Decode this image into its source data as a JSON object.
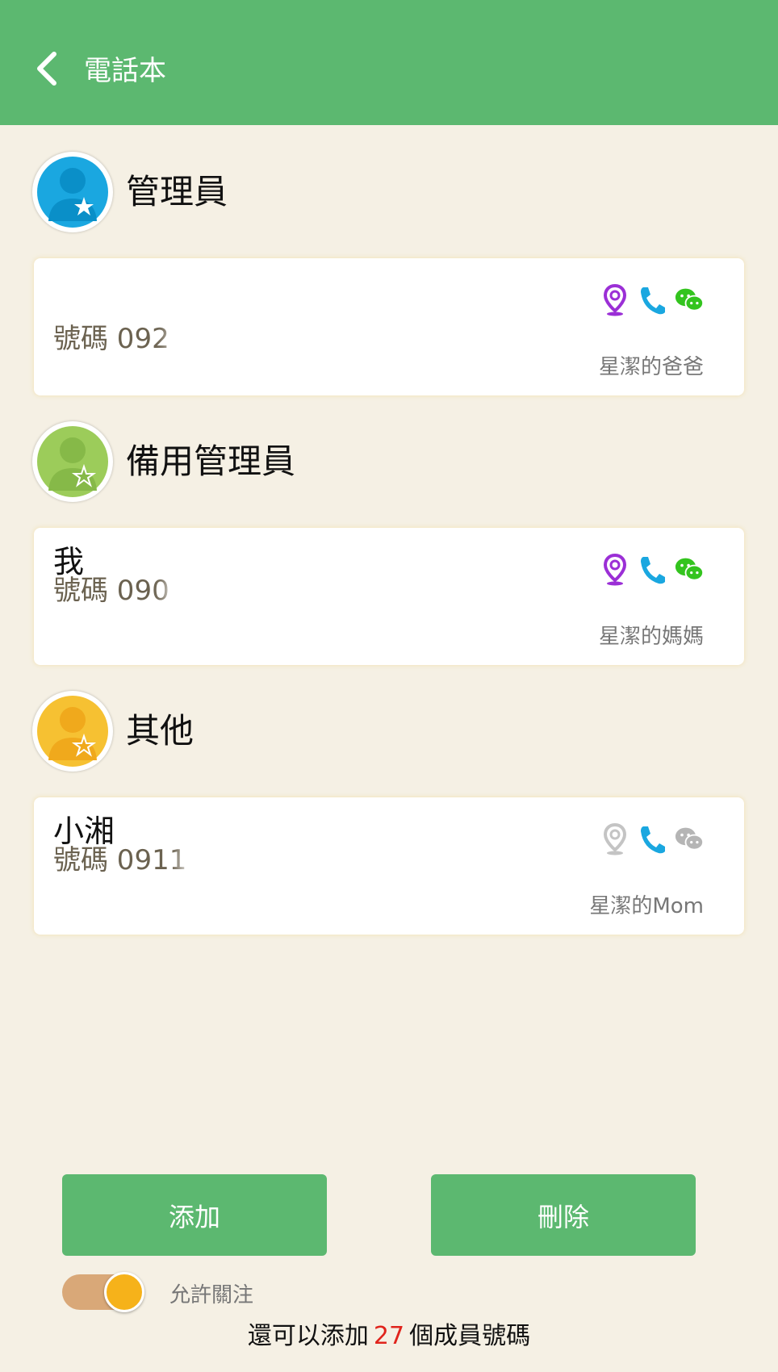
{
  "header": {
    "title": "電話本"
  },
  "groups": [
    {
      "title": "管理員",
      "avatar_color": "#1aa7e0",
      "contact": {
        "name": "",
        "phone": "號碼 092",
        "relation": "星潔的爸爸",
        "icons": [
          "location-icon",
          "phone-icon",
          "wechat-icon"
        ],
        "active": true
      }
    },
    {
      "title": "備用管理員",
      "avatar_color": "#9ccc5a",
      "contact": {
        "name": "我",
        "phone": "號碼 090",
        "relation": "星潔的媽媽",
        "icons": [
          "location-icon",
          "phone-icon",
          "wechat-icon"
        ],
        "active": true
      }
    },
    {
      "title": "其他",
      "avatar_color": "#f6c132",
      "contact": {
        "name": "小湘",
        "phone": "號碼 0911",
        "relation": "星潔的Mom",
        "icons": [
          "location-icon",
          "phone-icon",
          "wechat-icon"
        ],
        "active": false
      }
    }
  ],
  "buttons": {
    "add": "添加",
    "delete": "刪除"
  },
  "toggle": {
    "label": "允許關注",
    "on": true
  },
  "footer": {
    "prefix": "還可以添加",
    "count": "27",
    "suffix": "個成員號碼"
  },
  "colors": {
    "header": "#5cb870",
    "location_active": "#9b2fd6",
    "phone": "#1aa7e0",
    "wechat_active": "#33c41e",
    "inactive": "#c4c4c4"
  }
}
